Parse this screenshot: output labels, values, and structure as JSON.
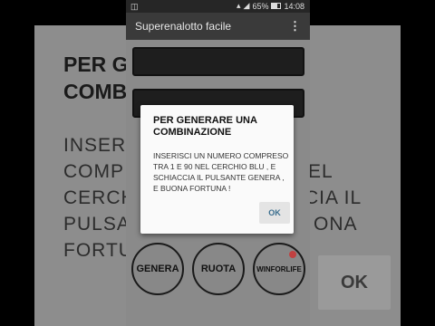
{
  "background": {
    "title_lines": "PER G\nCOMB",
    "body_lines": "INSERI\nCOMP\nCERCH\nPULSA\nFORTU",
    "right_fragments": [
      "EL",
      "CIA IL",
      "ONA"
    ],
    "ok_label": "OK"
  },
  "status_bar": {
    "left_icon": "message-icon",
    "battery_percent": "65%",
    "time": "14:08"
  },
  "app_bar": {
    "title": "Superenalotto facile",
    "menu_icon": "⋮"
  },
  "buttons": {
    "genera": "GENERA",
    "ruota": "RUOTA",
    "winforlife": "WINFORLIFE"
  },
  "dialog": {
    "title": "PER GENERARE UNA COMBINAZIONE",
    "message": "INSERISCI UN NUMERO COMPRESO TRA 1 E 90 NEL CERCHIO BLU , E SCHIACCIA IL PULSANTE GENERA , E BUONA FORTUNA !",
    "ok_label": "OK"
  }
}
